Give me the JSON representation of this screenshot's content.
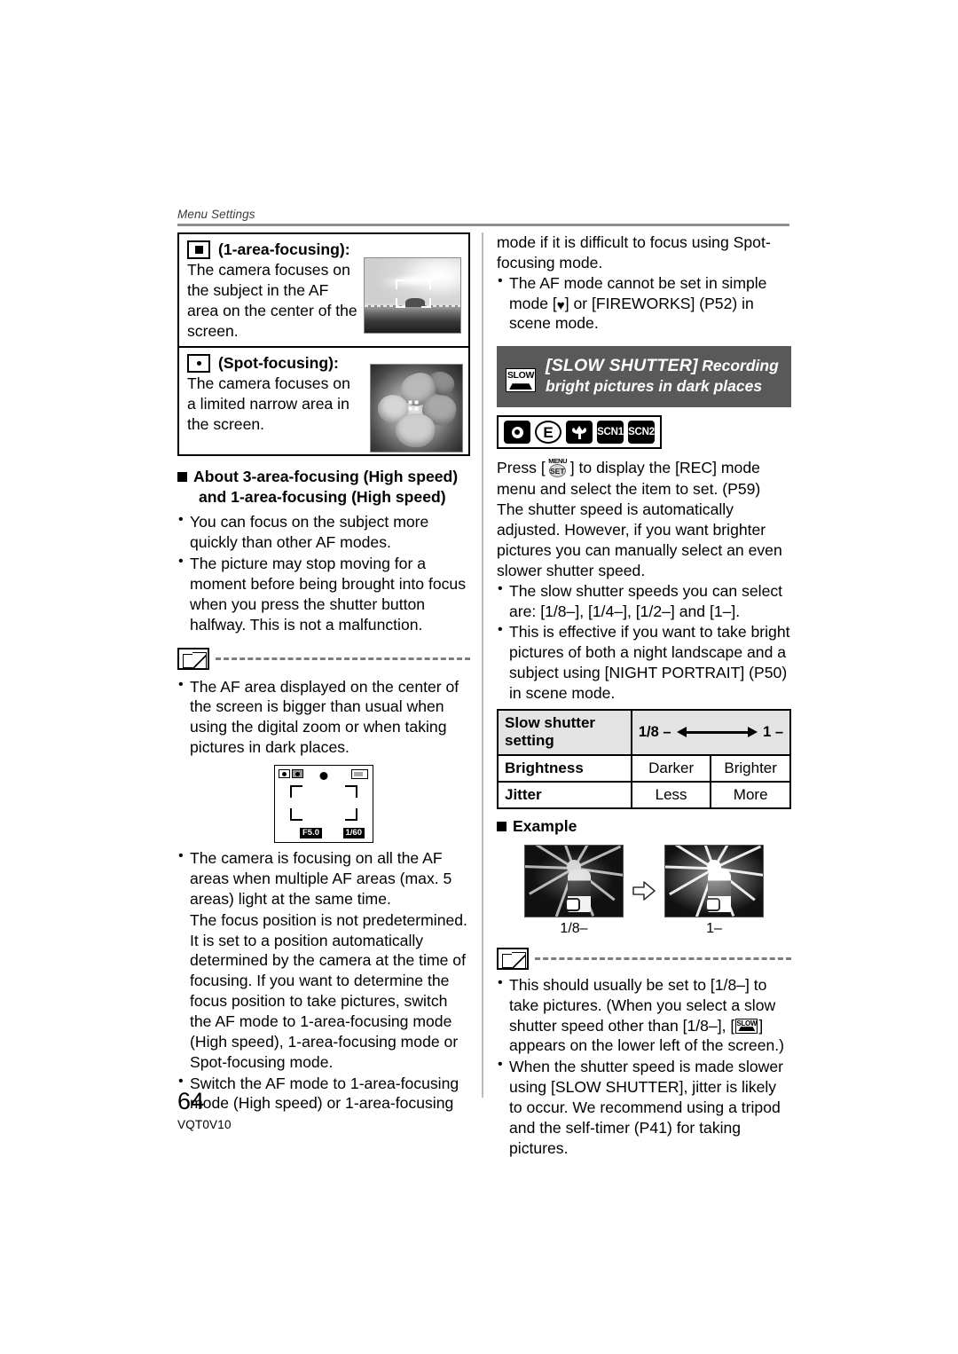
{
  "page": {
    "running_head": "Menu Settings",
    "page_number": "64",
    "doc_code": "VQT0V10"
  },
  "left_column": {
    "af_box": {
      "modes": [
        {
          "icon": "filled-square-icon",
          "title": "(1-area-focusing):",
          "body": "The camera focuses on the subject in the AF area on the center of the screen.",
          "photo": "seascape-pier-photo"
        },
        {
          "icon": "small-dot-icon",
          "title": "(Spot-focusing):",
          "body": "The camera focuses on a limited narrow area in the screen.",
          "photo": "flower-closeup-photo"
        }
      ]
    },
    "about_heading_line1": "About 3-area-focusing (High speed)",
    "about_heading_line2": "and 1-area-focusing (High speed)",
    "about_bullets": [
      "You can focus on the subject more quickly than other AF modes.",
      "The picture may stop moving for a moment before being brought into focus when you press the shutter button halfway. This is not a malfunction."
    ],
    "note_bullets_1": [
      "The AF area displayed on the center of the screen is bigger than usual when using the digital zoom or when taking pictures in dark places."
    ],
    "lcd_illustration": {
      "aperture": "F5.0",
      "shutter_speed": "1/60"
    },
    "note_bullets_2": [
      "The camera is focusing on all the AF areas when multiple AF areas (max. 5 areas) light at the same time.",
      "The focus position is not predetermined. It is set to a position automatically determined by the camera at the time of focusing. If you want to determine the focus position to take pictures, switch the AF mode to 1-area-focusing mode (High speed), 1-area-focusing mode or Spot-focusing mode.",
      "Switch the AF mode to 1-area-focusing mode (High speed) or 1-area-focusing"
    ]
  },
  "right_column": {
    "continued_text": "mode if it is difficult to focus using Spot-focusing mode.",
    "top_bullet_pre": "The AF mode cannot be set in simple mode [",
    "top_bullet_post": "] or [FIREWORKS] (P52) in scene mode.",
    "banner": {
      "icon": "slow-shutter-icon",
      "icon_label": "SLOW",
      "title": "[SLOW SHUTTER]",
      "subtitle": "Recording bright pictures in dark places",
      "background_color": "#595959"
    },
    "mode_icons": [
      {
        "name": "normal-picture-mode-icon",
        "label": ""
      },
      {
        "name": "simple-mode-icon",
        "label": "E"
      },
      {
        "name": "macro-mode-icon",
        "label": ""
      },
      {
        "name": "scene-mode-1-icon",
        "label": "SCN1"
      },
      {
        "name": "scene-mode-2-icon",
        "label": "SCN2"
      }
    ],
    "instruction_pre": "Press [",
    "instruction_post": "] to display the [REC] mode menu and select the item to set. (P59) The shutter speed is automatically adjusted. However, if you want brighter pictures you can manually select an even slower shutter speed.",
    "menu_set_icon": {
      "top": "MENU",
      "bottom": "SET"
    },
    "bullets": [
      "The slow shutter speeds you can select are:  [1/8–], [1/4–], [1/2–] and [1–].",
      "This is effective if you want to take bright pictures of both a night landscape and a subject using [NIGHT PORTRAIT] (P50) in scene mode."
    ],
    "table": {
      "rows": [
        {
          "label": "Slow shutter setting",
          "left": "1/8 –",
          "right": "1 –",
          "is_arrow_row": true
        },
        {
          "label": "Brightness",
          "left": "Darker",
          "right": "Brighter",
          "is_arrow_row": false
        },
        {
          "label": "Jitter",
          "left": "Less",
          "right": "More",
          "is_arrow_row": false
        }
      ]
    },
    "example_heading": "Example",
    "example_shots": [
      {
        "label": "1/8–",
        "name": "ferris-wheel-dark-photo"
      },
      {
        "label": "1–",
        "name": "ferris-wheel-bright-photo"
      }
    ],
    "note_bullets": [
      {
        "pre": "This should usually be set to [1/8–] to take pictures. (When you select a slow shutter speed other than [1/8–], [",
        "post": "] appears on the lower left of the screen.)",
        "has_icon": true
      },
      {
        "pre": "When the shutter speed is made slower using [SLOW SHUTTER], jitter is likely to occur. We recommend using a tripod and the self-timer (P41) for taking pictures.",
        "post": "",
        "has_icon": false
      }
    ]
  }
}
